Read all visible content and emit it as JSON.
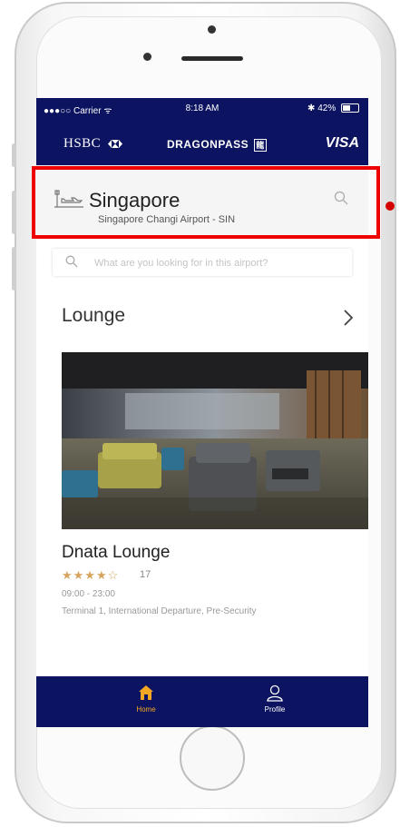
{
  "status_bar": {
    "carrier": "●●●○○ Carrier ᯤ",
    "time": "8:18 AM",
    "battery": "✱ 42%",
    "battery_level_fraction": 0.42
  },
  "brand_bar": {
    "bank": "HSBC",
    "partner": "DRAGONPASS",
    "partner_badge": "龍",
    "card": "VISA"
  },
  "airport": {
    "city": "Singapore",
    "name": "Singapore Changi Airport - SIN"
  },
  "search": {
    "placeholder": "What are you looking for in this airport?"
  },
  "section": {
    "title": "Lounge"
  },
  "lounge": {
    "name": "Dnata Lounge",
    "stars_filled": "★★★★",
    "stars_empty": "☆",
    "rating_count": "17",
    "hours": "09:00 - 23:00",
    "location": "Terminal 1, International Departure, Pre-Security"
  },
  "tabs": [
    {
      "label": "Home",
      "icon": "home-icon"
    },
    {
      "label": "Profile",
      "icon": "profile-icon"
    }
  ],
  "colors": {
    "nav": "#0c1360",
    "active_tab": "#f5a623",
    "highlight": "#ee0000"
  }
}
